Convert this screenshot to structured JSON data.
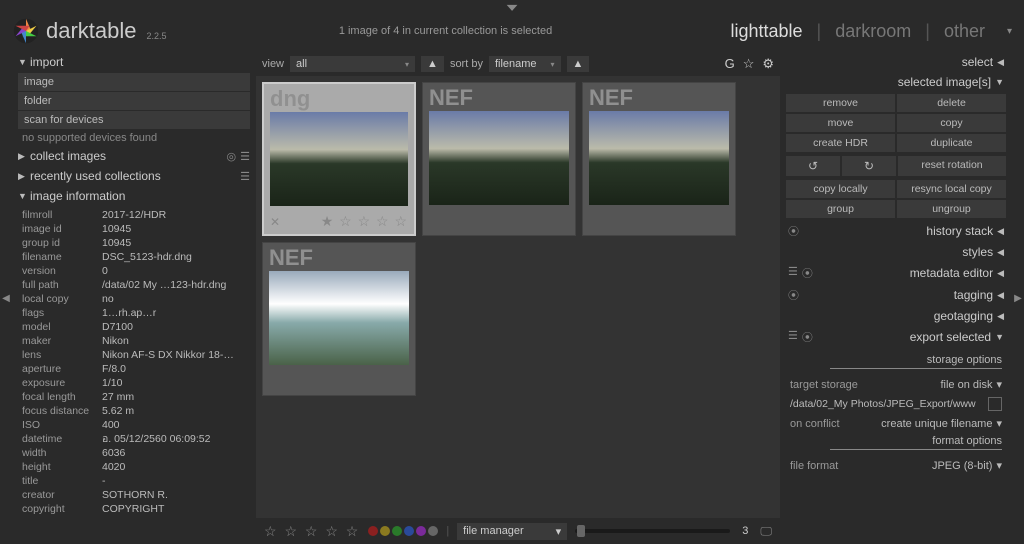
{
  "app": {
    "name": "darktable",
    "version": "2.2.5"
  },
  "header": {
    "status": "1 image of 4 in current collection is selected",
    "modes": [
      "lighttable",
      "darkroom",
      "other"
    ],
    "active_mode": "lighttable"
  },
  "toolbar": {
    "view_label": "view",
    "view_value": "all",
    "sort_label": "sort by",
    "sort_value": "filename",
    "icons": {
      "g": "G",
      "star": "☆",
      "gear": "⚙"
    }
  },
  "left": {
    "import": {
      "title": "import",
      "items": [
        "image",
        "folder",
        "scan for devices"
      ],
      "status": "no supported devices found"
    },
    "collect": {
      "title": "collect images"
    },
    "recent": {
      "title": "recently used collections"
    },
    "info": {
      "title": "image information",
      "rows": [
        {
          "label": "filmroll",
          "value": "2017-12/HDR"
        },
        {
          "label": "image id",
          "value": "10945"
        },
        {
          "label": "group id",
          "value": "10945"
        },
        {
          "label": "filename",
          "value": "DSC_5123-hdr.dng"
        },
        {
          "label": "version",
          "value": "0"
        },
        {
          "label": "full path",
          "value": "/data/02 My …123-hdr.dng"
        },
        {
          "label": "local copy",
          "value": "no"
        },
        {
          "label": "flags",
          "value": "1…rh.ap…r"
        },
        {
          "label": "model",
          "value": "D7100"
        },
        {
          "label": "maker",
          "value": "Nikon"
        },
        {
          "label": "lens",
          "value": "Nikon AF-S DX Nikkor 18-…"
        },
        {
          "label": "aperture",
          "value": "F/8.0"
        },
        {
          "label": "exposure",
          "value": "1/10"
        },
        {
          "label": "focal length",
          "value": "27 mm"
        },
        {
          "label": "focus distance",
          "value": "5.62 m"
        },
        {
          "label": "ISO",
          "value": "400"
        },
        {
          "label": "datetime",
          "value": "อ. 05/12/2560 06:09:52"
        },
        {
          "label": "width",
          "value": "6036"
        },
        {
          "label": "height",
          "value": "4020"
        },
        {
          "label": "title",
          "value": "-"
        },
        {
          "label": "creator",
          "value": "SOTHORN R."
        },
        {
          "label": "copyright",
          "value": "COPYRIGHT"
        }
      ]
    }
  },
  "thumbs": [
    {
      "format": "dng",
      "selected": true,
      "bright": false
    },
    {
      "format": "NEF",
      "selected": false,
      "bright": false
    },
    {
      "format": "NEF",
      "selected": false,
      "bright": false
    },
    {
      "format": "NEF",
      "selected": false,
      "bright": true
    }
  ],
  "bottom": {
    "layout": "file manager",
    "zoom": "3",
    "colors": [
      "#8b2020",
      "#8b7a20",
      "#2a7a2a",
      "#2a4a9a",
      "#7a2a9a",
      "#666"
    ]
  },
  "right": {
    "select": "select",
    "selected_images": {
      "title": "selected image[s]",
      "actions": [
        [
          "remove",
          "delete"
        ],
        [
          "move",
          "copy"
        ],
        [
          "create HDR",
          "duplicate"
        ],
        [
          "↺",
          "↻",
          "reset rotation"
        ],
        [
          "copy locally",
          "resync local copy"
        ],
        [
          "group",
          "ungroup"
        ]
      ]
    },
    "panels": {
      "history": "history stack",
      "styles": "styles",
      "metadata": "metadata editor",
      "tagging": "tagging",
      "geotagging": "geotagging",
      "export": "export selected"
    },
    "export": {
      "storage_section": "storage options",
      "target_storage_label": "target storage",
      "target_storage_value": "file on disk",
      "path": "/data/02_My Photos/JPEG_Export/www",
      "conflict_label": "on conflict",
      "conflict_value": "create unique filename",
      "format_section": "format options",
      "file_format_label": "file format",
      "file_format_value": "JPEG (8-bit)"
    }
  }
}
